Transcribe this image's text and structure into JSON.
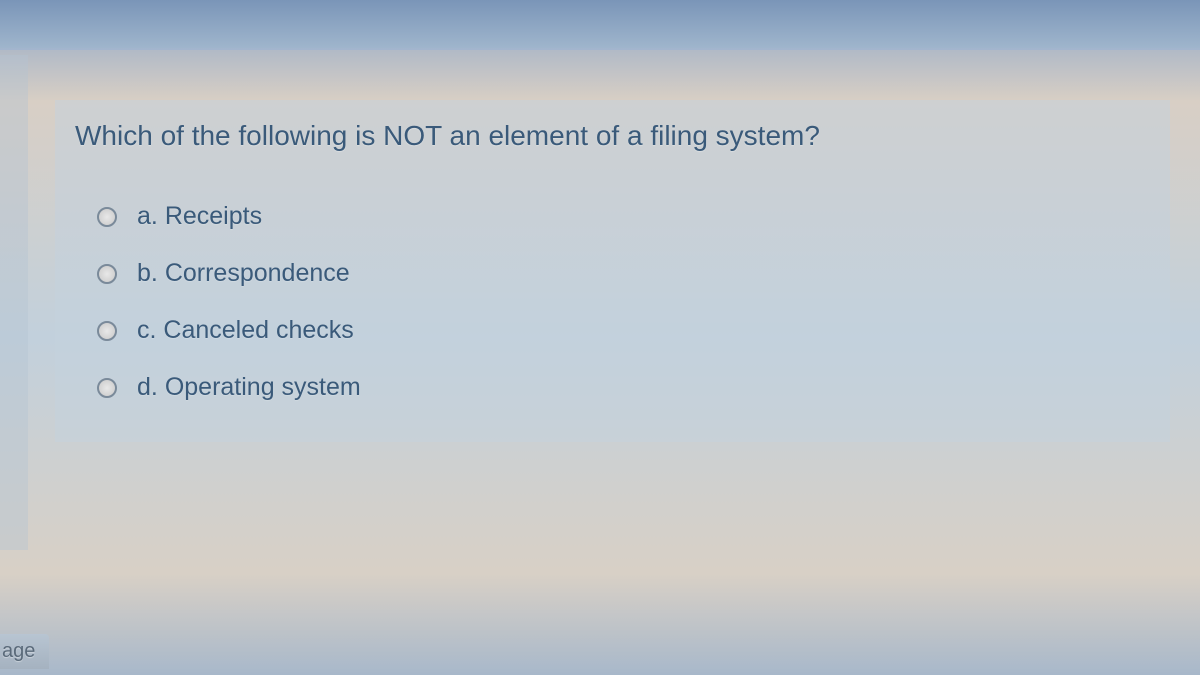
{
  "question": {
    "text": "Which of the following is NOT an element of a filing system?",
    "options": [
      {
        "letter": "a.",
        "label": "Receipts"
      },
      {
        "letter": "b.",
        "label": "Correspondence"
      },
      {
        "letter": "c.",
        "label": "Canceled checks"
      },
      {
        "letter": "d.",
        "label": "Operating system"
      }
    ]
  },
  "nav": {
    "page_button": "age"
  }
}
